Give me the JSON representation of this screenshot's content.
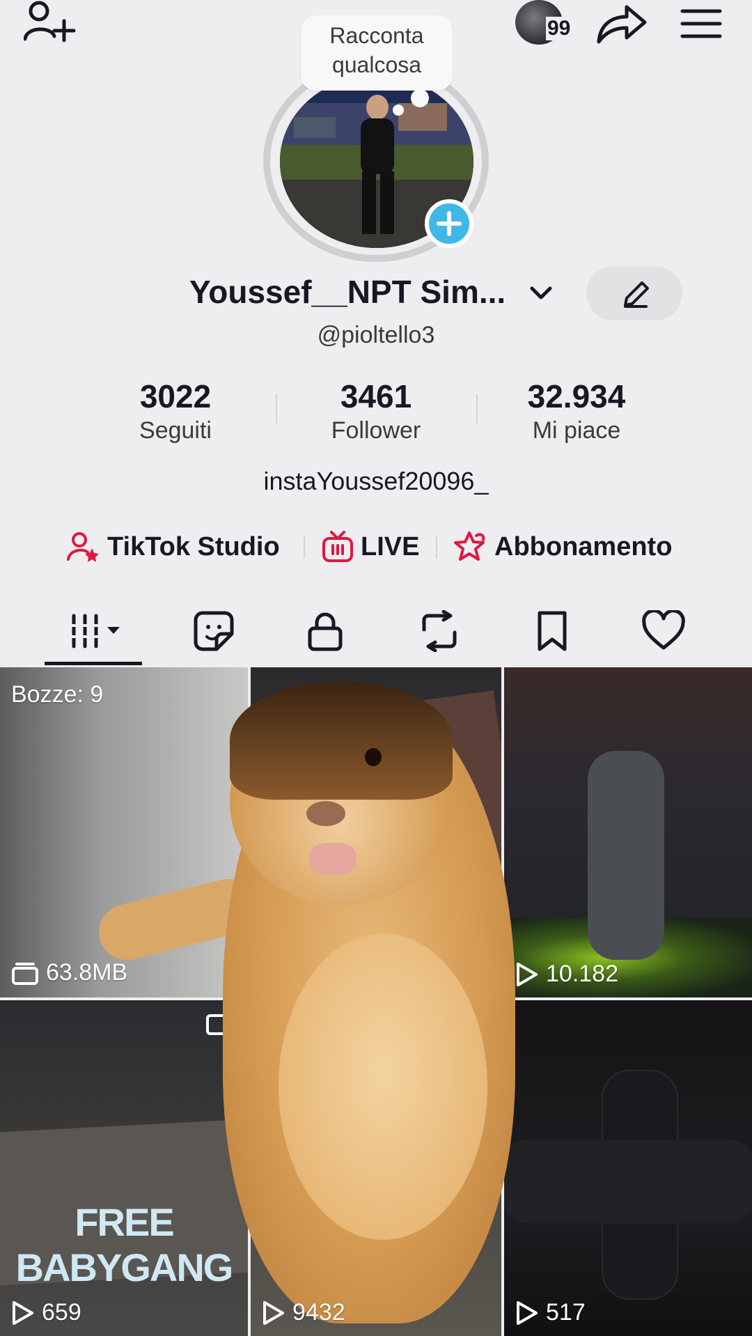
{
  "header": {
    "inbox_count": "99",
    "story_prompt": "Racconta qualcosa"
  },
  "profile": {
    "display_name": "Youssef__NPT Sim...",
    "handle": "@pioltello3",
    "bio": "instaYoussef20096_"
  },
  "stats": [
    {
      "value": "3022",
      "label": "Seguiti"
    },
    {
      "value": "3461",
      "label": "Follower"
    },
    {
      "value": "32.934",
      "label": "Mi piace"
    }
  ],
  "links": [
    {
      "label": "TikTok Studio",
      "icon": "creator-studio-icon"
    },
    {
      "label": "LIVE",
      "icon": "live-tv-icon"
    },
    {
      "label": "Abbonamento",
      "icon": "subscription-star-icon"
    }
  ],
  "tabs": [
    {
      "icon": "grid-videos-icon",
      "selected": true
    },
    {
      "icon": "sticker-icon"
    },
    {
      "icon": "lock-icon"
    },
    {
      "icon": "repost-icon"
    },
    {
      "icon": "bookmark-icon"
    },
    {
      "icon": "heart-icon"
    }
  ],
  "grid": [
    {
      "label": "Bozze: 9",
      "size": "63.8MB"
    },
    {
      "views": ""
    },
    {
      "views": "10.182"
    },
    {
      "views": "659",
      "banner": "FREE BABYGANG"
    },
    {
      "views": "9432"
    },
    {
      "views": "517"
    }
  ],
  "colors": {
    "accent_red": "#e0163f",
    "plus_blue": "#3fb8e8",
    "background": "#eeeef0"
  }
}
